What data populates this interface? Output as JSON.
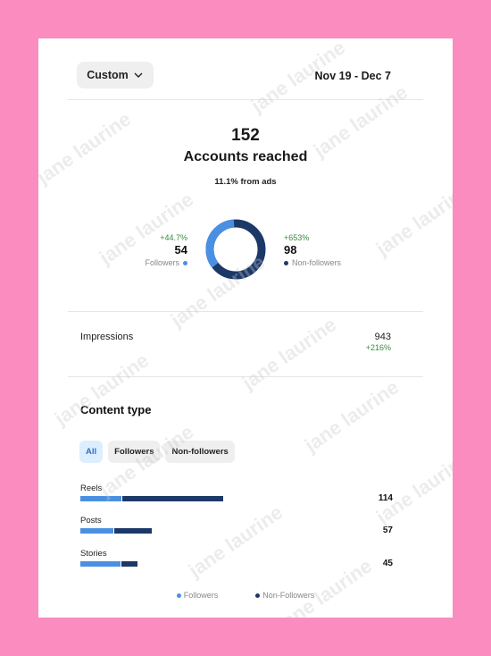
{
  "header": {
    "filter_label": "Custom",
    "date_range": "Nov 19 - Dec 7"
  },
  "summary": {
    "accounts_reached_value": "152",
    "accounts_reached_label": "Accounts reached",
    "from_ads": "11.1% from ads"
  },
  "followers": {
    "change": "+44.7%",
    "value": "54",
    "label": "Followers",
    "fraction": 0.355
  },
  "non_followers": {
    "change": "+653%",
    "value": "98",
    "label": "Non-followers",
    "fraction": 0.645
  },
  "impressions": {
    "label": "Impressions",
    "value": "943",
    "change": "+216%"
  },
  "content_type": {
    "title": "Content type",
    "filters": [
      "All",
      "Followers",
      "Non-followers"
    ],
    "active_filter": "All",
    "rows": [
      {
        "label": "Reels",
        "value": "114",
        "followers_fraction": 0.29,
        "total_fraction": 0.91
      },
      {
        "label": "Posts",
        "value": "57",
        "followers_fraction": 0.47,
        "total_fraction": 0.45
      },
      {
        "label": "Stories",
        "value": "45",
        "followers_fraction": 0.71,
        "total_fraction": 0.36
      }
    ],
    "legend": [
      "Followers",
      "Non-Followers"
    ]
  },
  "watermark_text": "jane laurine",
  "colors": {
    "background": "#fb8cbf",
    "followers": "#4a90e2",
    "non_followers": "#1c3868",
    "positive": "#3a8b3f",
    "active_chip_bg": "#dceeff"
  }
}
